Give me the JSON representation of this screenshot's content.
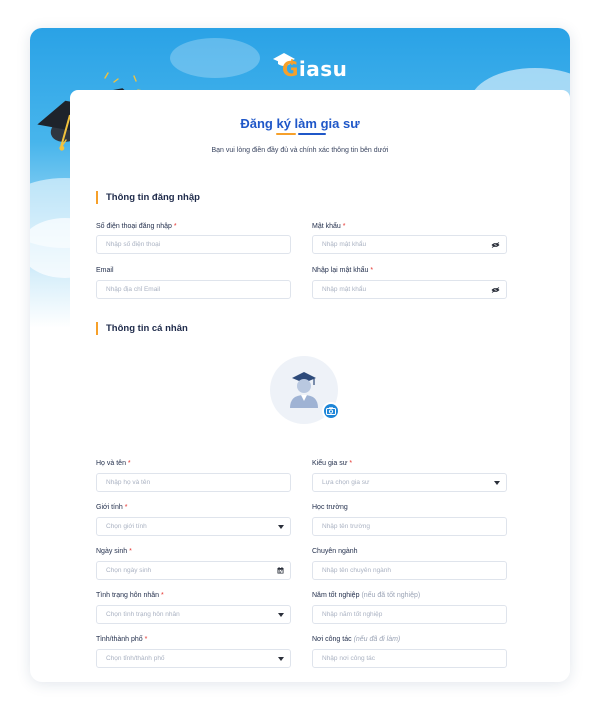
{
  "brand": {
    "logo_initial": "G",
    "logo_rest": "iasu"
  },
  "page": {
    "title": "Đăng ký làm gia sư",
    "subtitle": "Bạn vui lòng điền đầy đủ và chính xác thông tin bên dưới"
  },
  "colors": {
    "accent": "#f6a02a",
    "primary": "#1f57c8",
    "required": "#e5322d",
    "sky": "#2aa2e6"
  },
  "login_section": {
    "title": "Thông tin đăng nhập",
    "phone": {
      "label": "Số điện thoại đăng nhập",
      "required": "*",
      "placeholder": "Nhập số điện thoại"
    },
    "password": {
      "label": "Mật khẩu",
      "required": "*",
      "placeholder": "Nhập mật khẩu",
      "icon": "eye-icon"
    },
    "email": {
      "label": "Email",
      "placeholder": "Nhập địa chỉ Email"
    },
    "confirm_password": {
      "label": "Nhập lại mật khẩu",
      "required": "*",
      "placeholder": "Nhập mật khẩu",
      "icon": "eye-icon"
    }
  },
  "personal_section": {
    "title": "Thông tin cá nhân",
    "avatar": {
      "icon": "graduate-avatar-icon",
      "upload_icon": "camera-icon"
    },
    "full_name": {
      "label": "Họ và tên",
      "required": "*",
      "placeholder": "Nhập họ và tên"
    },
    "tutor_type": {
      "label": "Kiểu gia sư",
      "required": "*",
      "placeholder": "Lựa chọn gia sư",
      "icon": "caret-down-icon"
    },
    "gender": {
      "label": "Giới tính",
      "required": "*",
      "placeholder": "Chọn giới tính",
      "icon": "caret-down-icon"
    },
    "school": {
      "label": "Học trường",
      "placeholder": "Nhập tên trường"
    },
    "birthday": {
      "label": "Ngày sinh",
      "required": "*",
      "placeholder": "Chọn ngày sinh",
      "icon": "calendar-icon"
    },
    "major": {
      "label": "Chuyên ngành",
      "placeholder": "Nhập tên chuyên ngành"
    },
    "marital": {
      "label": "Tình trạng hôn nhân",
      "required": "*",
      "placeholder": "Chọn tình trạng hôn nhân",
      "icon": "caret-down-icon"
    },
    "grad_year": {
      "label": "Năm tốt nghiệp",
      "hint": "(nếu đã tốt nghiệp)",
      "placeholder": "Nhập năm tốt nghiệp"
    },
    "city": {
      "label": "Tỉnh/thành phố",
      "required": "*",
      "placeholder": "Chọn tỉnh/thành phố",
      "icon": "caret-down-icon"
    },
    "workplace": {
      "label": "Nơi công tác",
      "hint": "(nếu đã đi làm)",
      "placeholder": "Nhập nơi công tác"
    }
  }
}
